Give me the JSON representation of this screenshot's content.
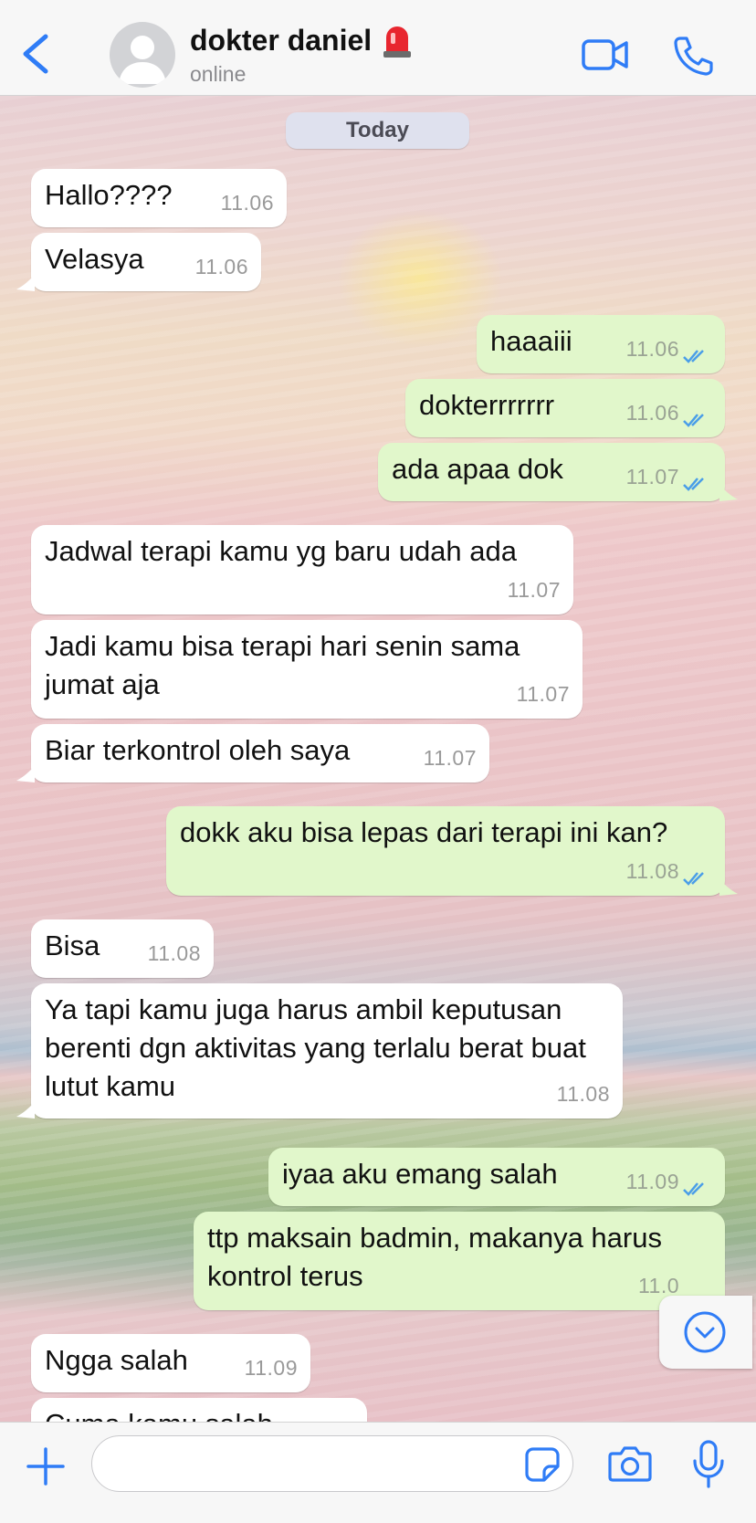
{
  "header": {
    "contact_name": "dokter daniel",
    "status": "online",
    "icons": {
      "back": "chevron-left-icon",
      "avatar": "person-placeholder-icon",
      "emoji": "police-light-emoji",
      "video": "video-camera-icon",
      "call": "phone-icon"
    },
    "accent_color": "#2f7cf6"
  },
  "chat": {
    "date_label": "Today",
    "messages": [
      {
        "direction": "in",
        "text": "Hallo????",
        "time": "11.06"
      },
      {
        "direction": "in",
        "text": "Velasya",
        "time": "11.06"
      },
      {
        "direction": "out",
        "text": "haaaiii",
        "time": "11.06",
        "status": "read"
      },
      {
        "direction": "out",
        "text": "dokterrrrrrr",
        "time": "11.06",
        "status": "read"
      },
      {
        "direction": "out",
        "text": "ada apaa dok",
        "time": "11.07",
        "status": "read"
      },
      {
        "direction": "in",
        "text": "Jadwal terapi kamu yg baru udah ada",
        "time": "11.07"
      },
      {
        "direction": "in",
        "text": "Jadi kamu bisa terapi hari senin sama jumat aja",
        "time": "11.07"
      },
      {
        "direction": "in",
        "text": "Biar terkontrol oleh saya",
        "time": "11.07"
      },
      {
        "direction": "out",
        "text": "dokk aku bisa lepas dari terapi ini kan?",
        "time": "11.08",
        "status": "read"
      },
      {
        "direction": "in",
        "text": "Bisa",
        "time": "11.08"
      },
      {
        "direction": "in",
        "text": "Ya tapi kamu juga harus ambil keputusan berenti dgn aktivitas yang terlalu berat buat lutut kamu",
        "time": "11.08"
      },
      {
        "direction": "out",
        "text": "iyaa aku emang salah",
        "time": "11.09",
        "status": "read"
      },
      {
        "direction": "out",
        "text": "ttp maksain badmin, makanya harus kontrol terus",
        "time": "11.0",
        "status": "read"
      },
      {
        "direction": "in",
        "text": "Ngga salah",
        "time": "11.09"
      },
      {
        "direction": "in",
        "text": "Cuma kamu salah",
        "time": ""
      }
    ],
    "bubble_colors": {
      "incoming": "#ffffff",
      "outgoing": "#e1f7cb",
      "ticks": "#4a9ee8"
    }
  },
  "input_bar": {
    "placeholder": "",
    "icons": {
      "plus": "plus-icon",
      "sticker": "sticker-icon",
      "camera": "camera-icon",
      "mic": "microphone-icon",
      "scroll_down": "chevron-down-circle-icon"
    }
  }
}
